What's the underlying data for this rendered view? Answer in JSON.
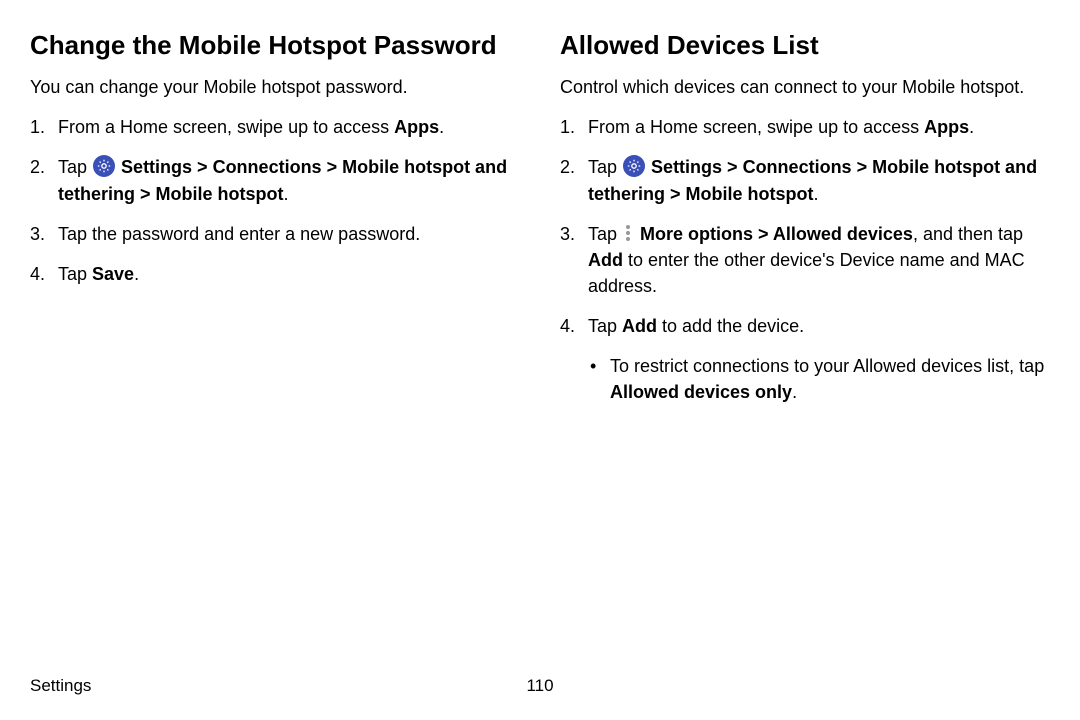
{
  "footer": {
    "section": "Settings",
    "page": "110"
  },
  "left": {
    "heading": "Change the Mobile Hotspot Password",
    "intro": "You can change your Mobile hotspot password.",
    "steps": {
      "s1": {
        "pre": "From a Home screen, swipe up to access ",
        "bold": "Apps",
        "post": "."
      },
      "s2": {
        "pre": "Tap ",
        "bold": "Settings > Connections > Mobile hotspot and tethering > Mobile hotspot",
        "post": "."
      },
      "s3": {
        "text": "Tap the password and enter a new password."
      },
      "s4": {
        "pre": "Tap ",
        "bold": "Save",
        "post": "."
      }
    }
  },
  "right": {
    "heading": "Allowed Devices List",
    "intro": "Control which devices can connect to your Mobile hotspot.",
    "steps": {
      "s1": {
        "pre": "From a Home screen, swipe up to access ",
        "bold": "Apps",
        "post": "."
      },
      "s2": {
        "pre": "Tap ",
        "bold": "Settings > Connections > Mobile hotspot and tethering > Mobile hotspot",
        "post": "."
      },
      "s3": {
        "pre": "Tap ",
        "bold1": "More options > Allowed devices",
        "mid": ", and then tap ",
        "bold2": "Add",
        "post": " to enter the other device's Device name and MAC address."
      },
      "s4": {
        "pre": "Tap ",
        "bold": "Add",
        "post": " to add the device."
      },
      "bullet": {
        "pre": "To restrict connections to your Allowed devices list, tap ",
        "bold": "Allowed devices only",
        "post": "."
      }
    }
  }
}
